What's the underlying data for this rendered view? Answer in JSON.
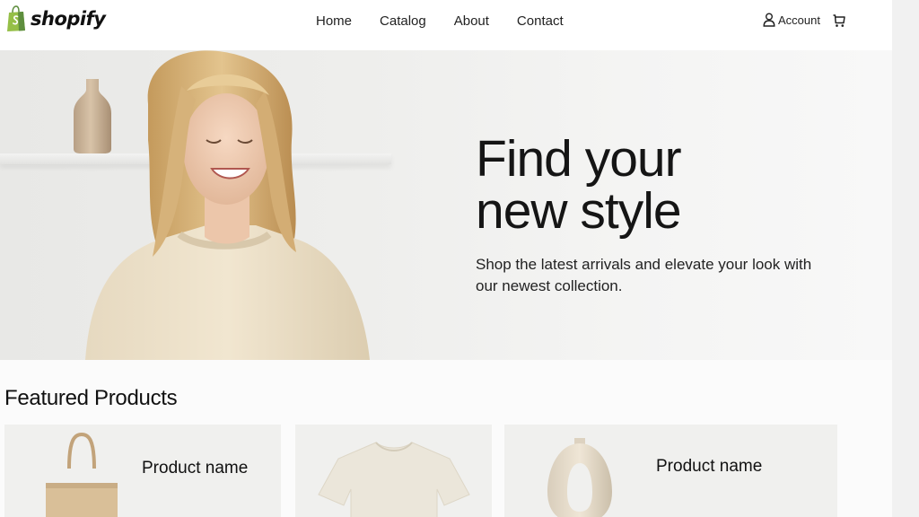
{
  "header": {
    "logo_text": "shopify",
    "nav": [
      "Home",
      "Catalog",
      "About",
      "Contact"
    ],
    "account_label": "Account",
    "icons": {
      "account": "person-icon",
      "cart": "cart-icon"
    }
  },
  "hero": {
    "title_line1": "Find your",
    "title_line2": "new style",
    "subtitle": "Shop the latest arrivals and elevate your look with our newest collection."
  },
  "featured": {
    "title": "Featured Products",
    "products": [
      {
        "name": "Product name",
        "image": "tote-bag"
      },
      {
        "name": "",
        "image": "t-shirt"
      },
      {
        "name": "Product name",
        "image": "ring-vase"
      }
    ]
  },
  "colors": {
    "brand_green": "#95bf47",
    "text": "#151515",
    "card_bg": "#f0f0ee"
  }
}
